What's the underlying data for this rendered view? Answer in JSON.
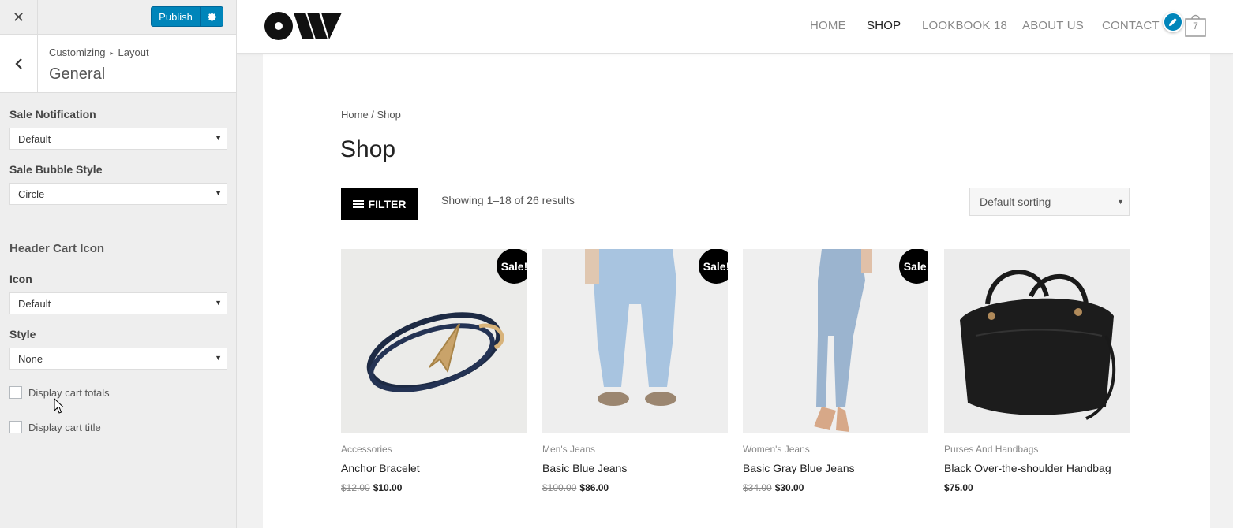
{
  "customizer": {
    "publish_label": "Publish",
    "breadcrumb_root": "Customizing",
    "breadcrumb_sep": "▸",
    "breadcrumb_current": "Layout",
    "section_title": "General",
    "sale_notification": {
      "label": "Sale Notification",
      "value": "Default"
    },
    "sale_bubble_style": {
      "label": "Sale Bubble Style",
      "value": "Circle"
    },
    "header_cart_heading": "Header Cart Icon",
    "icon": {
      "label": "Icon",
      "value": "Default"
    },
    "style": {
      "label": "Style",
      "value": "None"
    },
    "display_cart_totals": {
      "label": "Display cart totals",
      "checked": false
    },
    "display_cart_title": {
      "label": "Display cart title",
      "checked": false
    }
  },
  "site": {
    "nav": [
      "HOME",
      "SHOP",
      "LOOKBOOK 18",
      "ABOUT US",
      "CONTACT U"
    ],
    "active_nav": "SHOP",
    "cart_count": "7"
  },
  "shop": {
    "breadcrumb": "Home / Shop",
    "title": "Shop",
    "filter_label": "FILTER",
    "result_count": "Showing 1–18 of 26 results",
    "sorting": "Default sorting",
    "products": [
      {
        "category": "Accessories",
        "name": "Anchor Bracelet",
        "old_price": "$12.00",
        "price": "$10.00",
        "sale": "Sale!"
      },
      {
        "category": "Men's Jeans",
        "name": "Basic Blue Jeans",
        "old_price": "$100.00",
        "price": "$86.00",
        "sale": "Sale!"
      },
      {
        "category": "Women's Jeans",
        "name": "Basic Gray Blue Jeans",
        "old_price": "$34.00",
        "price": "$30.00",
        "sale": "Sale!"
      },
      {
        "category": "Purses And Handbags",
        "name": "Black Over-the-shoulder Handbag",
        "old_price": "",
        "price": "$75.00",
        "sale": ""
      }
    ]
  },
  "colors": {
    "accent": "#0085ba",
    "badge": "#000000"
  }
}
